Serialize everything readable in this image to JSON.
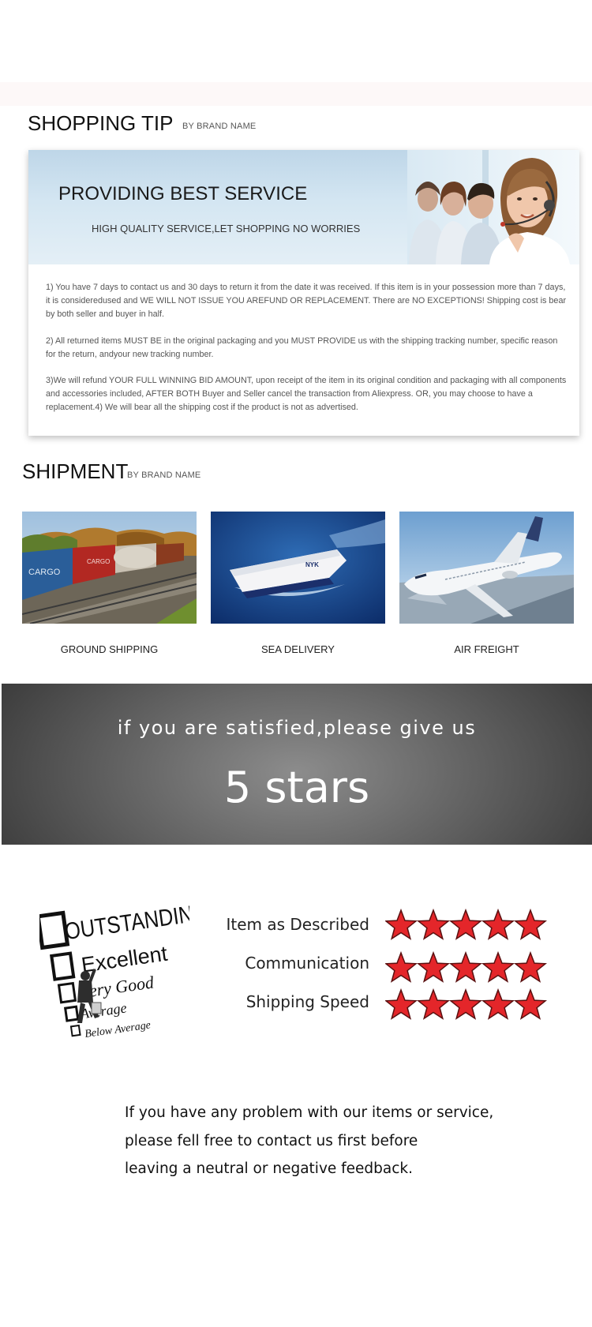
{
  "shopping_tip": {
    "title": "SHOPPING TIP",
    "subtitle": "BY BRAND NAME",
    "banner_title": "PROVIDING BEST SERVICE",
    "banner_subtitle": "HIGH QUALITY SERVICE,LET SHOPPING NO WORRIES",
    "paragraphs": [
      "1) You have 7 days to contact us and 30 days to return it from the date it was received. If this item is in your possession more than 7 days, it is consideredused and WE WILL NOT ISSUE YOU AREFUND OR REPLACEMENT. There are NO EXCEPTIONS! Shipping cost is bear by both seller and buyer in half.",
      "2) All returned items MUST BE in the original packaging and you MUST PROVIDE us with the shipping tracking number, specific reason for the return, andyour new tracking number.",
      "3)We will refund YOUR FULL WINNING BID AMOUNT, upon receipt of the item in its original condition and packaging with all components and accessories included, AFTER BOTH Buyer and Seller cancel the transaction from Aliexpress. OR, you may choose to have a replacement.4) We will bear all the shipping cost if the product is not as advertised."
    ]
  },
  "shipment": {
    "title": "SHIPMENT",
    "subtitle": "BY BRAND NAME",
    "items": [
      {
        "label": "GROUND SHIPPING",
        "container_text": "CARGO"
      },
      {
        "label": "SEA DELIVERY",
        "ship_text": "NYK"
      },
      {
        "label": "AIR FREIGHT"
      }
    ]
  },
  "five_stars": {
    "line1": "if you are satisfied,please give us",
    "line2": "5 stars"
  },
  "ratings": {
    "checklist": [
      "OUTSTANDING",
      "Excellent",
      "Very Good",
      "Average",
      "Below Average"
    ],
    "rows": [
      {
        "label": "Item as Described",
        "stars": 5
      },
      {
        "label": "Communication",
        "stars": 5
      },
      {
        "label": "Shipping Speed",
        "stars": 5
      }
    ],
    "star_color": "#e4262a"
  },
  "contact": {
    "lines": [
      "If you have any problem with our items or service,",
      "please fell free to contact us first before",
      "leaving a neutral or negative feedback."
    ]
  }
}
